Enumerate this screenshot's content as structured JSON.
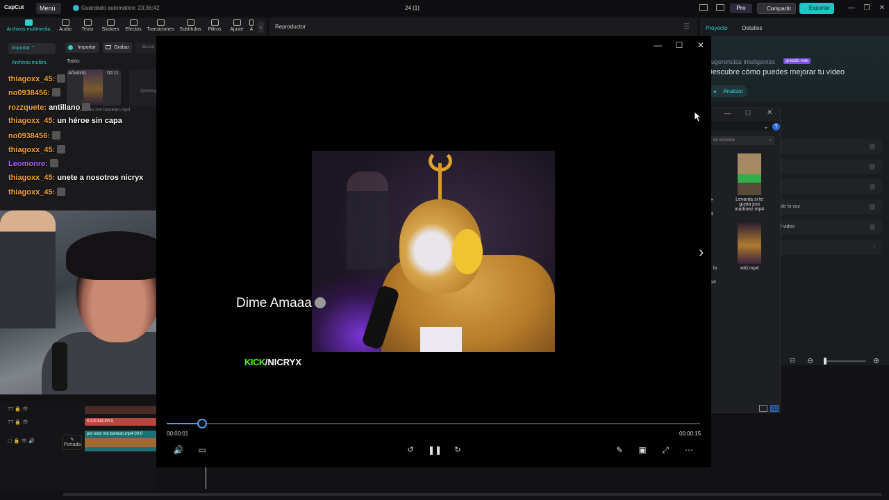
{
  "titlebar": {
    "logo": "CapCut",
    "menu": "Menú",
    "autosave": "Guardado automático: 23:36:42",
    "doc_title": "24 (1)",
    "pro": "Pro",
    "share": "Compartir",
    "export": "Exportar"
  },
  "toolbar": {
    "items": [
      "Archivos multimedia",
      "Audio",
      "Texto",
      "Stickers",
      "Efectos",
      "Transiciones",
      "Subtítulos",
      "Filtros",
      "Ajuste",
      "A"
    ]
  },
  "media": {
    "import_dropdown": "Importar",
    "side_label": "Archivos multim.",
    "import_button": "Importar",
    "record_button": "Grabar",
    "search_placeholder": "Busca",
    "filter": "Todos",
    "thumb_badge": "Añadido",
    "thumb_duration": "00:11",
    "thumb_name": "por esto me banean.mp4",
    "generate_label": "Genera"
  },
  "chat": [
    {
      "user": "thiagoxx_45:",
      "msg": "",
      "color": "orange",
      "emote": true
    },
    {
      "user": "no0938456:",
      "msg": "",
      "color": "orange",
      "emote": true
    },
    {
      "user": "rozzquete:",
      "msg": "antillano",
      "color": "orange",
      "emote": true
    },
    {
      "user": "thiagoxx_45:",
      "msg": "un héroe sin capa",
      "color": "orange",
      "emote": false
    },
    {
      "user": "no0938456:",
      "msg": "",
      "color": "orange",
      "emote": true
    },
    {
      "user": "thiagoxx_45:",
      "msg": "",
      "color": "orange",
      "emote": true
    },
    {
      "user": "Leomonre:",
      "msg": "",
      "color": "purple",
      "emote": true
    },
    {
      "user": "thiagoxx_45:",
      "msg": "unete a nosotros nicryx",
      "color": "orange",
      "emote": false
    },
    {
      "user": "thiagoxx_45:",
      "msg": "",
      "color": "orange",
      "emote": true
    }
  ],
  "timeline": {
    "clip_title": "KICK/NICRYX",
    "clip_video": "por esto me banean.mp4",
    "clip_video_time": "00:0",
    "cover": "Portada"
  },
  "player_panel": {
    "title": "Reproductor"
  },
  "right_panel": {
    "tab_project": "Proyecto",
    "tab_details": "Detalles",
    "suggestion_title": "Sugerencias inteligentes",
    "suggestion_badge": "gratuito este",
    "suggestion_text": "Descubre cómo puedes mejorar tu video",
    "analyze": "Analizar",
    "rows": [
      "",
      "",
      "",
      "de la voz",
      "l video",
      ""
    ]
  },
  "explorer": {
    "search_placeholder": "de teletubie",
    "items": [
      {
        "name": "Levanta si te gusta josi martinez.mp4"
      },
      {
        "name": "xdd.mp4"
      }
    ],
    "partial_labels": [
      "e",
      "4",
      "lo",
      "p4"
    ]
  },
  "player": {
    "caption": "Dime Amaaa",
    "kick_green": "KICK",
    "kick_white": "/NICRYX",
    "time_current": "00:00:01",
    "time_total": "00:00:15",
    "progress_fraction": 0.066
  }
}
